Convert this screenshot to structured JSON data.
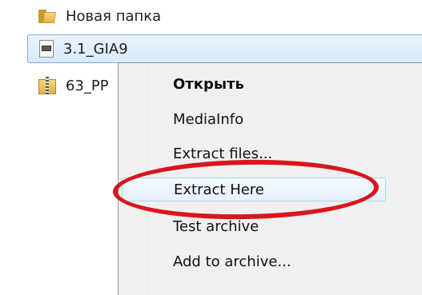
{
  "files": [
    {
      "name": "Новая папка",
      "icon": "folder-icon"
    },
    {
      "name": "3.1_GIA9",
      "icon": "document-icon",
      "selected": true
    },
    {
      "name": "63_PP",
      "icon": "archive-icon"
    }
  ],
  "context_menu": {
    "items": [
      {
        "label": "Открыть",
        "default": true
      },
      {
        "label": "MediaInfo"
      },
      {
        "label": "Extract files..."
      },
      {
        "label": "Extract Here",
        "highlighted": true
      },
      {
        "label": "Test archive"
      },
      {
        "label": "Add to archive..."
      }
    ]
  },
  "colors": {
    "selection_border": "#84acdd",
    "annotation": "#d9161c",
    "menu_background": "#f0f0f0"
  }
}
